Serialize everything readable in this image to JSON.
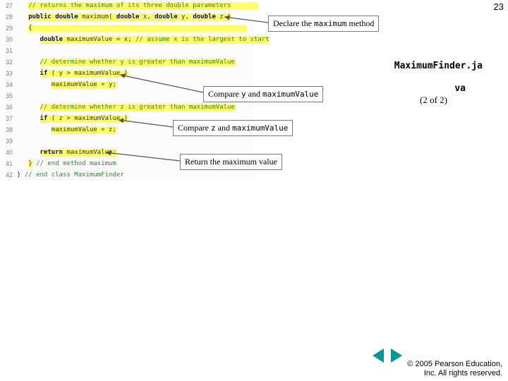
{
  "page_number": "23",
  "code": {
    "gutter": [
      "27",
      "28",
      "29",
      "30",
      "31",
      "32",
      "33",
      "34",
      "35",
      "36",
      "37",
      "38",
      "39",
      "40",
      "41",
      "42"
    ],
    "lines_html": [
      "   <span class='hl'><span class='cm'>// returns the maximum of its three double parameters</span>       </span>",
      "   <span class='hl'><span class='kw'>public</span> <span class='kw'>double</span> maximum( <span class='kw'>double</span> x, <span class='kw'>double</span> y, <span class='kw'>double</span> z )</span>",
      "   <span class='hl'>{                                                        </span>",
      "      <span class='hl'><span class='kw'>double</span> maximumValue = x; <span class='cm'>// assume x is the largest to start</span></span>",
      "",
      "      <span class='hl'><span class='cm'>// determine whether y is greater than maximumValue</span></span>",
      "      <span class='hl'><span class='kw'>if</span> ( y &gt; maximumValue )</span>",
      "         <span class='hl'>maximumValue = y;</span>",
      "",
      "      <span class='hl'><span class='cm'>// determine whether z is greater than maximumValue</span></span>",
      "      <span class='hl'><span class='kw'>if</span> ( z &gt; maximumValue )</span>",
      "         <span class='hl'>maximumValue = z;</span>",
      "",
      "      <span class='hl'><span class='kw'>return</span> maximumValue;</span>",
      "   <span class='hl'>}</span> <span class='cm'>// end method maximum</span>",
      "} <span class='cm'>// end class MaximumFinder</span>"
    ]
  },
  "callouts": {
    "declare": {
      "pre": "Declare the ",
      "mono": "maximum",
      "post": " method"
    },
    "cmp_y": {
      "pre": "Compare ",
      "m1": "y",
      "mid": " and ",
      "m2": "maximumValue"
    },
    "cmp_z": {
      "pre": "Compare ",
      "m1": "z",
      "mid": " and ",
      "m2": "maximumValue"
    },
    "ret": {
      "text": "Return the maximum value"
    }
  },
  "side": {
    "title": "MaximumFinder.ja",
    "sub": "va",
    "part": "(2 of 2)"
  },
  "copyright": {
    "line1": "© 2005 Pearson Education,",
    "line2": "Inc.  All rights reserved."
  }
}
